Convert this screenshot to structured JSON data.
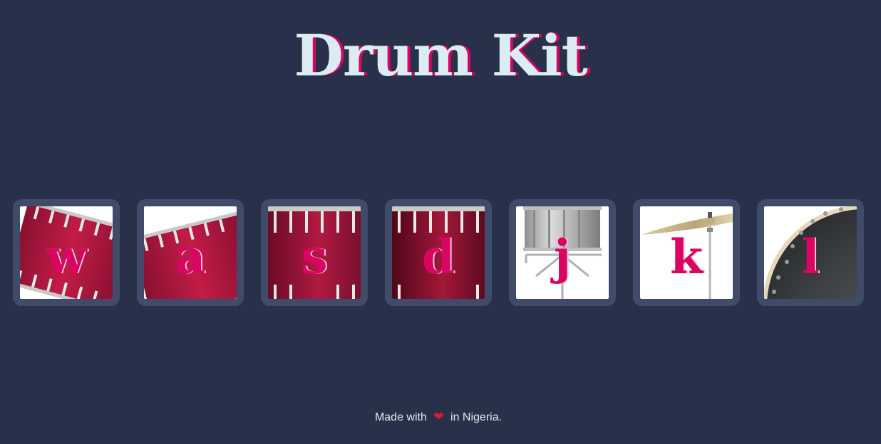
{
  "header": {
    "title": "Drum Kit"
  },
  "drums": [
    {
      "key": "w",
      "instrument_icon": "tom-1-icon"
    },
    {
      "key": "a",
      "instrument_icon": "tom-2-icon"
    },
    {
      "key": "s",
      "instrument_icon": "tom-3-icon"
    },
    {
      "key": "d",
      "instrument_icon": "tom-4-icon"
    },
    {
      "key": "j",
      "instrument_icon": "snare-icon"
    },
    {
      "key": "k",
      "instrument_icon": "crash-cymbal-icon"
    },
    {
      "key": "l",
      "instrument_icon": "kick-drum-icon"
    }
  ],
  "footer": {
    "prefix": "Made with",
    "heart_icon": "heart-icon",
    "suffix": "in Nigeria."
  },
  "colors": {
    "background": "#283149",
    "pad": "#404B69",
    "accent": "#DA0463",
    "text": "#DBEDF3"
  }
}
